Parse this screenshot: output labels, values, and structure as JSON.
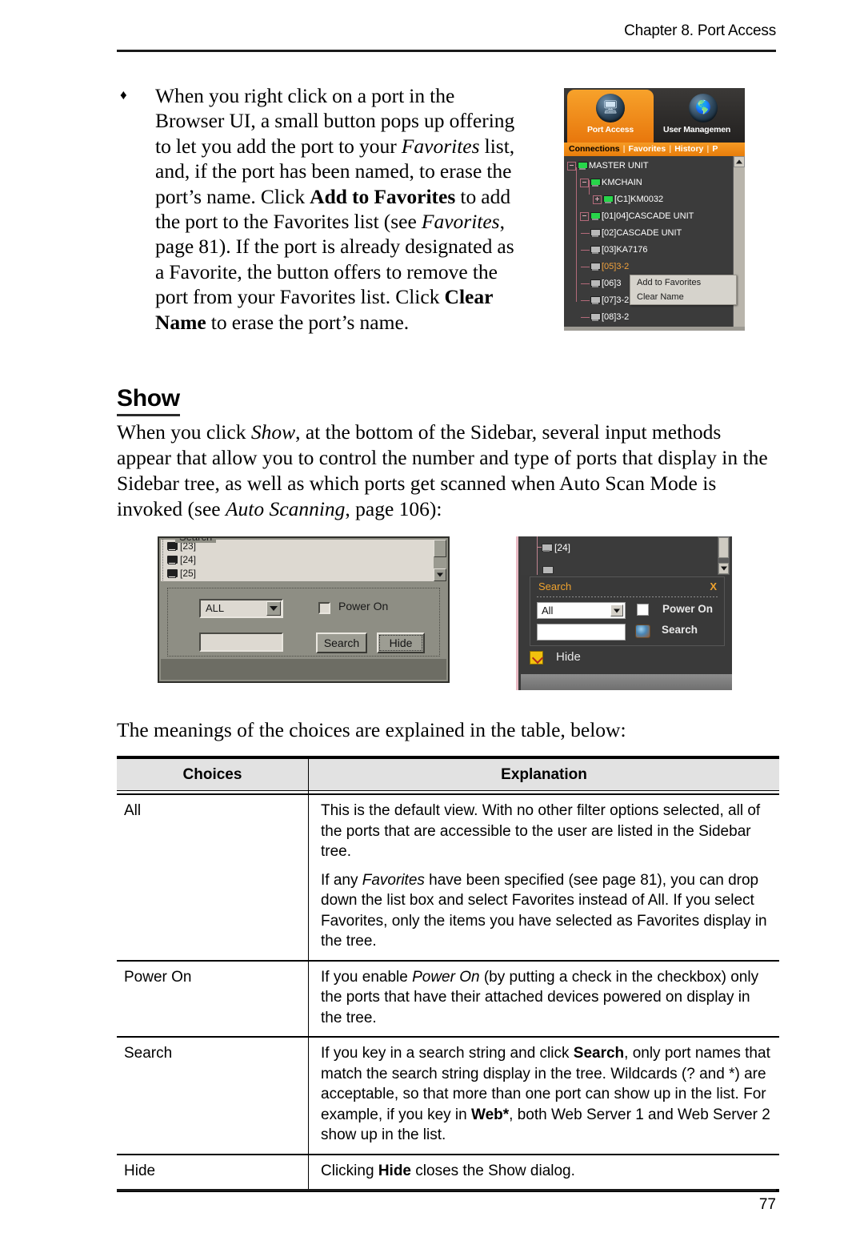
{
  "header": {
    "running_head": "Chapter 8. Port Access"
  },
  "footer": {
    "page_number": "77"
  },
  "bullet": {
    "marker": "♦",
    "line1": "When you right click on a port in the Browser UI, a small button pops up offering to let you add the port to your ",
    "favorites_italic_1": "Favorites",
    "line2": " list, and, if the port has been named, to erase the port’s name. Click ",
    "add_to_favorites_bold": "Add to Favorites",
    "line3": " to add the port to the Favorites list (see ",
    "favorites_italic_2": "Favorites",
    "line4": ", page 81). If the port is already designated as a Favorite, the button offers to remove the port from your Favorites list. Click ",
    "clear_name_bold": "Clear Name",
    "line5": " to erase the port’s name."
  },
  "section": {
    "heading": "Show",
    "para_part1": "When you click ",
    "para_show_italic": "Show",
    "para_part2": ", at the bottom of the Sidebar, several input methods appear that allow you to control the number and type of ports that display in the Sidebar tree, as well as which ports get scanned when Auto Scan Mode is invoked (see ",
    "para_autoscanning_italic": "Auto Scanning",
    "para_part3": ", page 106):",
    "table_lead": "The meanings of the choices are explained in the table, below:"
  },
  "screenshot_port_access": {
    "tabs": [
      {
        "label": "Port Access",
        "icon": "port-access-icon",
        "active": true
      },
      {
        "label": "User Managemen",
        "icon": "user-management-icon",
        "active": false
      }
    ],
    "subtabs": [
      "Connections",
      "Favorites",
      "History",
      "P"
    ],
    "tree_nodes": [
      {
        "label": "MASTER UNIT",
        "depth": 0,
        "expander": "minus",
        "icon": "monitor-green-icon",
        "highlight": false
      },
      {
        "label": "KMCHAIN",
        "depth": 1,
        "expander": "minus",
        "icon": "monitor-green-icon",
        "highlight": false
      },
      {
        "label": "[C1]KM0032",
        "depth": 2,
        "expander": "plus",
        "icon": "monitor-green-icon",
        "highlight": false
      },
      {
        "label": "[01|04]CASCADE UNIT",
        "depth": 1,
        "expander": "minus",
        "icon": "monitor-green-icon",
        "highlight": false
      },
      {
        "label": "[02]CASCADE UNIT",
        "depth": 1,
        "expander": "dash",
        "icon": "monitor-gray-icon",
        "highlight": false
      },
      {
        "label": "[03]KA7176",
        "depth": 1,
        "expander": "dash",
        "icon": "monitor-gray-icon",
        "highlight": false
      },
      {
        "label": "[05]3-2",
        "depth": 1,
        "expander": "dash",
        "icon": "monitor-gray-icon",
        "highlight": true
      },
      {
        "label": "[06]3",
        "depth": 1,
        "expander": "dash",
        "icon": "monitor-gray-icon",
        "highlight": false
      },
      {
        "label": "[07]3-2",
        "depth": 1,
        "expander": "dash",
        "icon": "monitor-gray-icon",
        "highlight": false
      },
      {
        "label": "[08]3-2",
        "depth": 1,
        "expander": "dash",
        "icon": "monitor-gray-icon",
        "highlight": false
      }
    ],
    "context_menu": [
      "Add to Favorites",
      "Clear Name"
    ],
    "colors": {
      "accent_orange": "#ef8a16",
      "tree_bg": "#3b3b3b",
      "highlight": "#f2a23c"
    }
  },
  "screenshot_classic_search": {
    "tree_nodes": [
      "[23]",
      "[24]",
      "[25]"
    ],
    "group_title": "Search",
    "combo_value": "ALL",
    "checkbox_label": "Power On",
    "checkbox_checked": false,
    "text_input_value": "",
    "buttons": [
      "Search",
      "Hide"
    ]
  },
  "screenshot_dark_search": {
    "tree_node": "[24]",
    "panel_title": "Search",
    "close_label": "X",
    "combo_value": "All",
    "checkbox_label": "Power On",
    "checkbox_checked": false,
    "text_input_value": "",
    "search_label": "Search",
    "hide_label": "Hide",
    "colors": {
      "title_orange": "#f0a32e",
      "panel_bg": "#393939",
      "hide_icon": "#f2c20e"
    }
  },
  "table": {
    "headers": [
      "Choices",
      "Explanation"
    ],
    "rows": [
      {
        "choice": "All",
        "paragraphs": [
          "This is the default view. With no other filter options selected, all of the ports that are accessible to the user are listed in the Sidebar tree.",
          "If any Favorites have been specified (see page 81), you can drop down the list box and select Favorites instead of All. If you select Favorites, only the items you have selected as Favorites display in the tree."
        ]
      },
      {
        "choice": "Power On",
        "paragraphs": [
          "If you enable Power On (by putting a check in the checkbox) only the ports that have their attached devices powered on display in the tree."
        ]
      },
      {
        "choice": "Search",
        "paragraphs": [
          "If you key in a search string and click Search, only port names that match the search string display in the tree. Wildcards (? and *) are acceptable, so that more than one port can show up in the list. For example, if you key in Web*, both Web Server 1 and Web Server 2 show up in the list."
        ]
      },
      {
        "choice": "Hide",
        "paragraphs": [
          "Clicking Hide closes the Show dialog."
        ]
      }
    ]
  }
}
